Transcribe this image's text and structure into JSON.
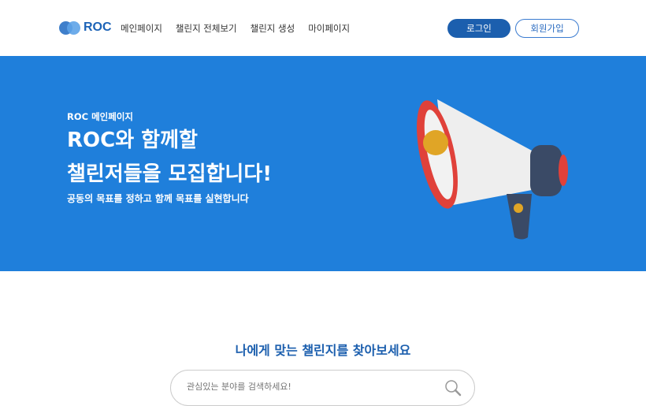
{
  "nav": {
    "logo": "ROC",
    "menu": [
      "메인페이지",
      "챌린지 전체보기",
      "챌린지 생성",
      "마이페이지"
    ],
    "login": "로그인",
    "signup": "회원가입"
  },
  "hero": {
    "subtitle": "ROC 메인페이지",
    "title_line1": "ROC와 함께할",
    "title_line2": "챌린저들을 모집합니다!",
    "description": "공동의 목표를 정하고 함께 목표를 실현합니다"
  },
  "search": {
    "heading": "나에게 맞는 챌린지를 찾아보세요",
    "placeholder": "관심있는 분야를 검색하세요!"
  },
  "colors": {
    "hero": "#1f7fdb",
    "brand": "#1c5fae"
  }
}
